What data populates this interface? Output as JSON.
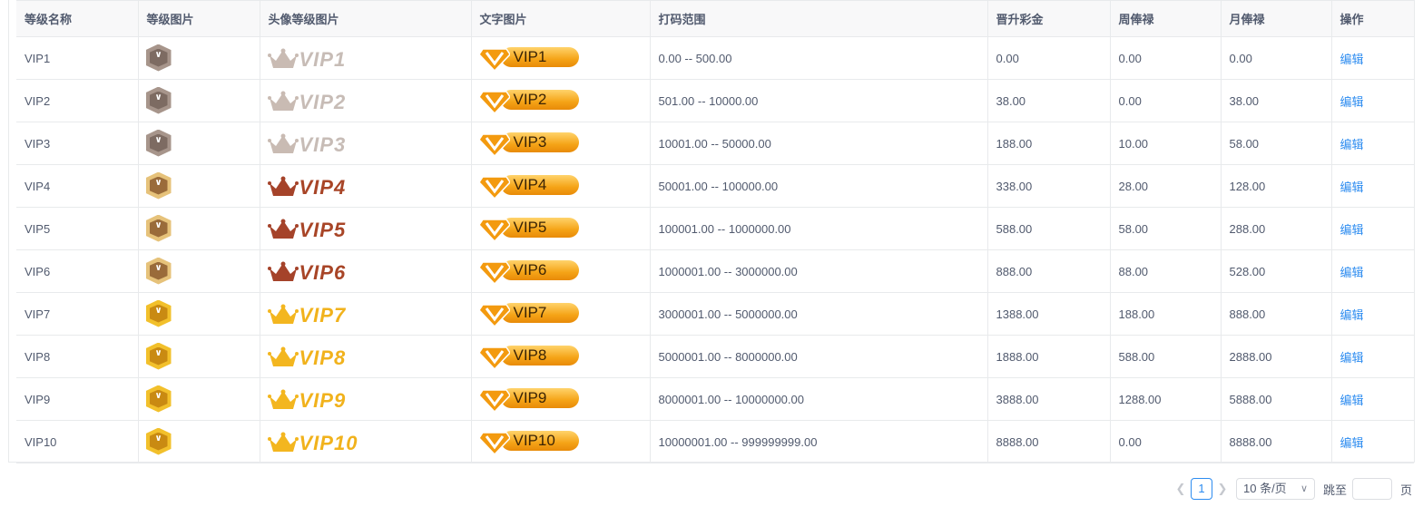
{
  "table": {
    "columns": [
      "等级名称",
      "等级图片",
      "头像等级图片",
      "文字图片",
      "打码范围",
      "晋升彩金",
      "周俸禄",
      "月俸禄",
      "操作"
    ],
    "rows": [
      {
        "name": "VIP1",
        "crown_label": "VIP1",
        "pill_label": "VIP1",
        "range": "0.00 -- 500.00",
        "promotion": "0.00",
        "weekly": "0.00",
        "monthly": "0.00",
        "action": "编辑",
        "tier": "silver"
      },
      {
        "name": "VIP2",
        "crown_label": "VIP2",
        "pill_label": "VIP2",
        "range": "501.00 -- 10000.00",
        "promotion": "38.00",
        "weekly": "0.00",
        "monthly": "38.00",
        "action": "编辑",
        "tier": "silver"
      },
      {
        "name": "VIP3",
        "crown_label": "VIP3",
        "pill_label": "VIP3",
        "range": "10001.00 -- 50000.00",
        "promotion": "188.00",
        "weekly": "10.00",
        "monthly": "58.00",
        "action": "编辑",
        "tier": "silver"
      },
      {
        "name": "VIP4",
        "crown_label": "VIP4",
        "pill_label": "VIP4",
        "range": "50001.00 -- 100000.00",
        "promotion": "338.00",
        "weekly": "28.00",
        "monthly": "128.00",
        "action": "编辑",
        "tier": "bronze"
      },
      {
        "name": "VIP5",
        "crown_label": "VIP5",
        "pill_label": "VIP5",
        "range": "100001.00 -- 1000000.00",
        "promotion": "588.00",
        "weekly": "58.00",
        "monthly": "288.00",
        "action": "编辑",
        "tier": "bronze"
      },
      {
        "name": "VIP6",
        "crown_label": "VIP6",
        "pill_label": "VIP6",
        "range": "1000001.00 -- 3000000.00",
        "promotion": "888.00",
        "weekly": "88.00",
        "monthly": "528.00",
        "action": "编辑",
        "tier": "bronze"
      },
      {
        "name": "VIP7",
        "crown_label": "VIP7",
        "pill_label": "VIP7",
        "range": "3000001.00 -- 5000000.00",
        "promotion": "1388.00",
        "weekly": "188.00",
        "monthly": "888.00",
        "action": "编辑",
        "tier": "gold"
      },
      {
        "name": "VIP8",
        "crown_label": "VIP8",
        "pill_label": "VIP8",
        "range": "5000001.00 -- 8000000.00",
        "promotion": "1888.00",
        "weekly": "588.00",
        "monthly": "2888.00",
        "action": "编辑",
        "tier": "gold"
      },
      {
        "name": "VIP9",
        "crown_label": "VIP9",
        "pill_label": "VIP9",
        "range": "8000001.00 -- 10000000.00",
        "promotion": "3888.00",
        "weekly": "1288.00",
        "monthly": "5888.00",
        "action": "编辑",
        "tier": "gold"
      },
      {
        "name": "VIP10",
        "crown_label": "VIP10",
        "pill_label": "VIP10",
        "range": "10000001.00 -- 999999999.00",
        "promotion": "8888.00",
        "weekly": "0.00",
        "monthly": "8888.00",
        "action": "编辑",
        "tier": "gold"
      }
    ]
  },
  "tiers": {
    "silver": {
      "badge_outer": "#a7958b",
      "badge_inner": "#7d6b62",
      "crown": "#c9bbb3",
      "text": "#c7bcb6"
    },
    "bronze": {
      "badge_outer": "#e6c27a",
      "badge_inner": "#9a6b3a",
      "crown": "#a5432a",
      "text": "#a84527"
    },
    "gold": {
      "badge_outer": "#f2c02b",
      "badge_inner": "#c98a12",
      "crown": "#f3b61f",
      "text": "#f1b21c"
    }
  },
  "pagination": {
    "prev_icon": "chevron-left-icon",
    "current_page": "1",
    "next_icon": "chevron-right-icon",
    "page_size": "10 条/页",
    "jump_label": "跳至",
    "unit_label": "页"
  },
  "colors": {
    "link": "#2d8cf0",
    "header_bg": "#f8f8f9",
    "border": "#e8eaec"
  }
}
